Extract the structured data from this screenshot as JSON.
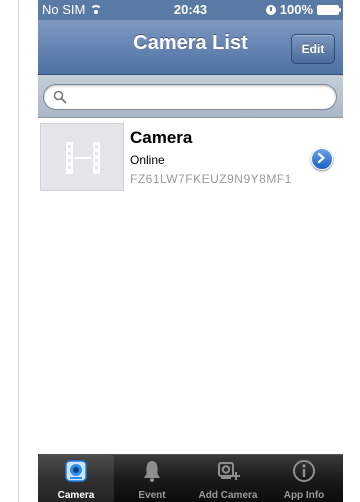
{
  "status_bar": {
    "carrier": "No SIM",
    "time": "20:43",
    "battery": "100%"
  },
  "nav": {
    "title": "Camera List",
    "edit_label": "Edit"
  },
  "search": {
    "placeholder": "",
    "value": ""
  },
  "cameras": [
    {
      "name": "Camera",
      "status": "Online",
      "id": "FZ61LW7FKEUZ9N9Y8MF1"
    }
  ],
  "tabs": [
    {
      "label": "Camera",
      "icon": "camera-icon",
      "active": true
    },
    {
      "label": "Event",
      "icon": "bell-icon",
      "active": false
    },
    {
      "label": "Add Camera",
      "icon": "add-camera-icon",
      "active": false
    },
    {
      "label": "App Info",
      "icon": "info-icon",
      "active": false
    }
  ],
  "colors": {
    "nav_bar": "#5a7aa6",
    "tab_bar": "#1a1a1a",
    "disclosure": "#1c5fc4"
  }
}
